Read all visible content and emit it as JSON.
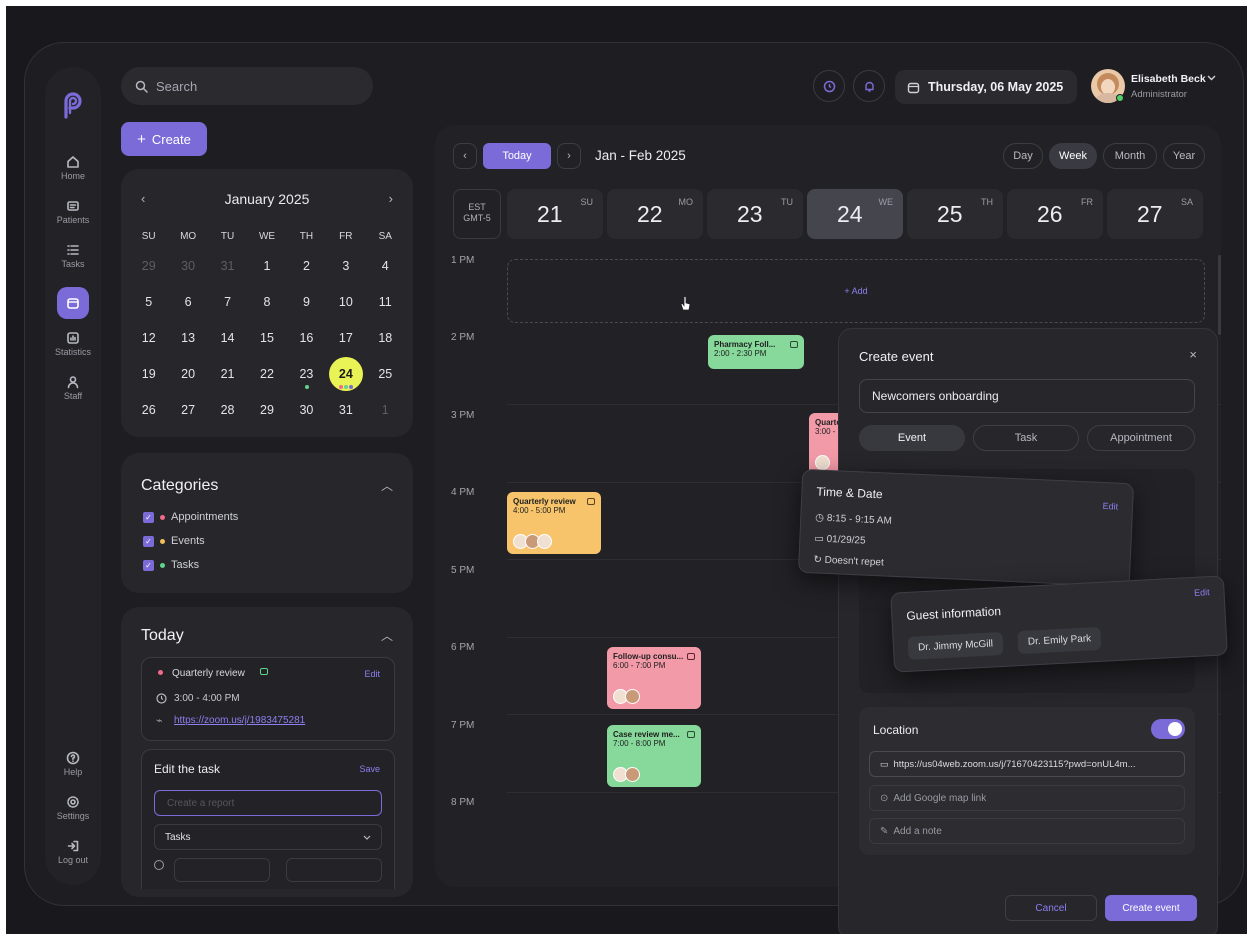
{
  "nav": {
    "items": [
      {
        "label": "Home",
        "icon": "home-icon"
      },
      {
        "label": "Patients",
        "icon": "patients-icon"
      },
      {
        "label": "Tasks",
        "icon": "tasks-icon"
      },
      {
        "label": "",
        "icon": "calendar-icon"
      },
      {
        "label": "Statistics",
        "icon": "statistics-icon"
      },
      {
        "label": "Staff",
        "icon": "staff-icon"
      }
    ],
    "bottom": [
      {
        "label": "Help",
        "icon": "help-icon"
      },
      {
        "label": "Settings",
        "icon": "settings-icon"
      },
      {
        "label": "Log out",
        "icon": "logout-icon"
      }
    ]
  },
  "search": {
    "placeholder": "Search"
  },
  "create_button": "Create",
  "header": {
    "date": "Thursday, 06 May 2025",
    "user_name": "Elisabeth Beck",
    "user_role": "Administrator"
  },
  "mini_calendar": {
    "month": "January 2025",
    "weekdays": [
      "SU",
      "MO",
      "TU",
      "WE",
      "TH",
      "FR",
      "SA"
    ],
    "days": [
      "29",
      "30",
      "31",
      "1",
      "2",
      "3",
      "4",
      "5",
      "6",
      "7",
      "8",
      "9",
      "10",
      "11",
      "12",
      "13",
      "14",
      "15",
      "16",
      "17",
      "18",
      "19",
      "20",
      "21",
      "22",
      "23",
      "24",
      "25",
      "26",
      "27",
      "28",
      "29",
      "30",
      "31",
      "1"
    ]
  },
  "categories": {
    "title": "Categories",
    "items": [
      {
        "label": "Appointments",
        "color": "#f06b8a"
      },
      {
        "label": "Events",
        "color": "#f3c058"
      },
      {
        "label": "Tasks",
        "color": "#5fd48a"
      }
    ]
  },
  "today": {
    "title": "Today",
    "event_title": "Quarterly review",
    "edit": "Edit",
    "time": "3:00 - 4:00 PM",
    "link": "https://zoom.us/j/1983475281",
    "edit_task": {
      "title": "Edit the task",
      "save": "Save",
      "placeholder": "Create a report",
      "select_value": "Tasks"
    }
  },
  "scheduler": {
    "today_button": "Today",
    "range": "Jan - Feb 2025",
    "views": [
      "Day",
      "Week",
      "Month",
      "Year"
    ],
    "timezone": [
      "EST",
      "GMT-5"
    ],
    "days": [
      {
        "num": "21",
        "dow": "SU"
      },
      {
        "num": "22",
        "dow": "MO"
      },
      {
        "num": "23",
        "dow": "TU"
      },
      {
        "num": "24",
        "dow": "WE"
      },
      {
        "num": "25",
        "dow": "TH"
      },
      {
        "num": "26",
        "dow": "FR"
      },
      {
        "num": "27",
        "dow": "SA"
      }
    ],
    "times": [
      "1 PM",
      "2 PM",
      "3 PM",
      "4 PM",
      "5 PM",
      "6 PM",
      "7 PM",
      "8 PM"
    ],
    "add_label": "+ Add",
    "events": [
      {
        "title": "Pharmacy Foll...",
        "time": "2:00 - 2:30 PM",
        "color": "#86d99a"
      },
      {
        "title": "Quarte",
        "time": "3:00 -",
        "color": "#f39aa8"
      },
      {
        "title": "Quarterly review",
        "time": "4:00 - 5:00 PM",
        "color": "#f7c46c"
      },
      {
        "title": "Follow-up consu...",
        "time": "6:00 - 7:00 PM",
        "color": "#f39aa8"
      },
      {
        "title": "Case review me...",
        "time": "7:00 - 8:00 PM",
        "color": "#86d99a"
      }
    ]
  },
  "create_event": {
    "title": "Create event",
    "name_value": "Newcomers onboarding",
    "tabs": [
      "Event",
      "Task",
      "Appointment"
    ],
    "time_date": {
      "title": "Time & Date",
      "edit": "Edit",
      "time": "8:15 - 9:15 AM",
      "date": "01/29/25",
      "repeat": "Doesn't repet"
    },
    "guests": {
      "title": "Guest information",
      "edit": "Edit",
      "list": [
        "Dr. Jimmy McGill",
        "Dr. Emily Park"
      ]
    },
    "location": {
      "title": "Location",
      "url": "https://us04web.zoom.us/j/71670423115?pwd=onUL4m...",
      "map_placeholder": "Add Google map link",
      "note_placeholder": "Add a note"
    },
    "cancel": "Cancel",
    "submit": "Create event"
  }
}
